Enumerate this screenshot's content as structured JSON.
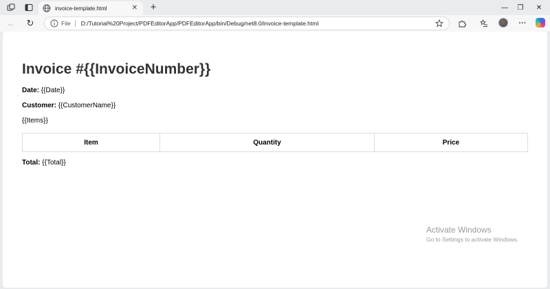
{
  "browser": {
    "tab": {
      "title": "invoice-template.html",
      "close_glyph": "✕"
    },
    "new_tab_glyph": "+",
    "window_controls": {
      "minimize": "—",
      "restore": "❐",
      "close": "✕"
    },
    "address": {
      "scheme_label": "File",
      "url": "D:/Tutorial%20Project/PDFEditorApp/PDFEditorApp/bin/Debug/net8.0/invoice-template.html"
    },
    "toolbar_glyphs": {
      "back": "←",
      "reload": "↻",
      "more": "···"
    }
  },
  "invoice": {
    "title": "Invoice #{{InvoiceNumber}}",
    "date_label": "Date:",
    "date_value": "{{Date}}",
    "customer_label": "Customer:",
    "customer_value": "{{CustomerName}}",
    "items_placeholder": "{{Items}}",
    "table": {
      "headers": [
        "Item",
        "Quantity",
        "Price"
      ]
    },
    "total_label": "Total:",
    "total_value": "{{Total}}"
  },
  "watermark": {
    "line1": "Activate Windows",
    "line2": "Go to Settings to activate Windows."
  },
  "icons": [
    "workspaces-icon",
    "tab-actions-icon",
    "globe-icon",
    "info-icon",
    "star-icon",
    "extensions-icon",
    "favorites-icon",
    "profile-avatar",
    "copilot-icon"
  ]
}
